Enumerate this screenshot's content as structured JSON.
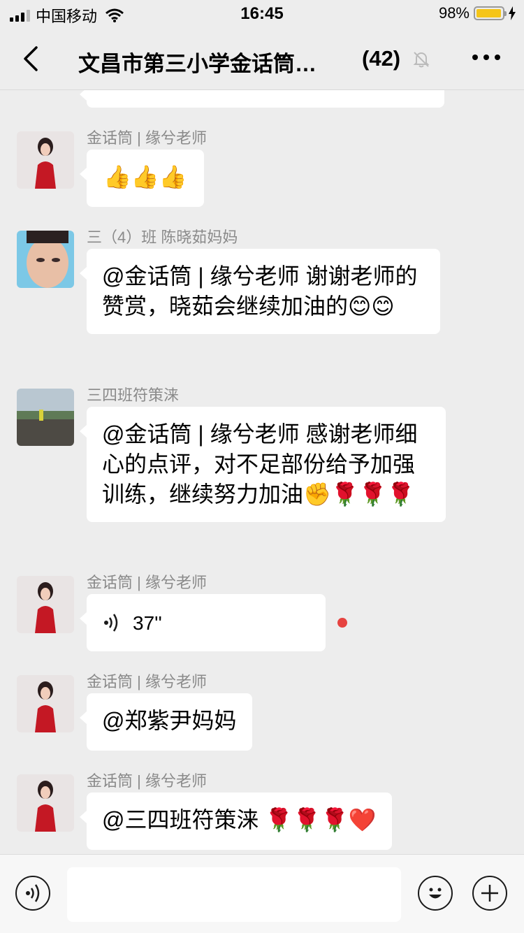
{
  "status_bar": {
    "carrier": "中国移动",
    "time": "16:45",
    "battery": "98%",
    "battery_level": 0.98
  },
  "nav": {
    "title": "文昌市第三小学金话筒…",
    "member_count": "(42)"
  },
  "messages": [
    {
      "sender": "金话筒 | 缘兮老师",
      "text": "👍👍👍"
    },
    {
      "sender": "三（4）班  陈晓茹妈妈",
      "text": "@金话筒 | 缘兮老师 谢谢老师的赞赏，晓茹会继续加油的😊😊"
    },
    {
      "sender": "三四班符策涞",
      "text": "@金话筒 | 缘兮老师 感谢老师细心的点评，对不足部份给予加强训练，继续努力加油✊🌹🌹🌹"
    },
    {
      "sender": "金话筒 | 缘兮老师",
      "voice_duration": "37''",
      "unread": true
    },
    {
      "sender": "金话筒 | 缘兮老师",
      "text": "@郑紫尹妈妈"
    },
    {
      "sender": "金话筒 | 缘兮老师",
      "text": "@三四班符策涞 🌹🌹🌹❤️"
    }
  ],
  "icons": [
    "back-chevron-icon",
    "mute-bell-icon",
    "more-dots-icon",
    "wifi-icon",
    "charging-icon",
    "voice-wave-icon",
    "voice-input-icon",
    "emoji-icon",
    "plus-icon"
  ],
  "colors": {
    "background": "#ededed",
    "bubble": "#ffffff",
    "sender": "#8a8a8a",
    "unread_dot": "#e64340",
    "battery_fill": "#f5c518"
  }
}
